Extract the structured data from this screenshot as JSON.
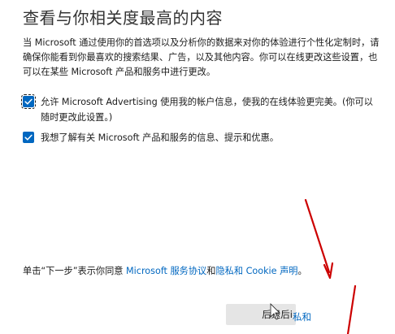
{
  "title": "查看与你相关度最高的内容",
  "description": "当 Microsoft 通过使用你的首选项以及分析你的数据来对你的体验进行个性化定制时，请确保你能看到你最喜欢的搜索结果、广告，以及其他内容。你可以在线更改这些设置，也可以在某些 Microsoft 产品和服务中进行更改。",
  "options": [
    {
      "label": "允许 Microsoft Advertising 使用我的帐户信息，使我的在线体验更完美。(你可以随时更改此设置。)",
      "checked": true
    },
    {
      "label": "我想了解有关 Microsoft 产品和服务的信息、提示和优惠。",
      "checked": true
    }
  ],
  "footer": {
    "prefix": "单击“下一步”表示你同意 ",
    "service_link": "Microsoft 服务协议",
    "middle": "和",
    "privacy_link": "隐私和 Cookie 声明",
    "suffix": "。"
  },
  "buttons": {
    "back_label": "后退",
    "back_overlap": "后i",
    "privacy_label": "私和"
  },
  "colors": {
    "accent": "#0067c0",
    "button_bg": "#e5e5e5",
    "annotation": "#cc0000"
  },
  "icons": {
    "checkbox": "checkmark-icon",
    "annotation": "red-arrow-icon",
    "cursor": "mouse-cursor-icon"
  }
}
